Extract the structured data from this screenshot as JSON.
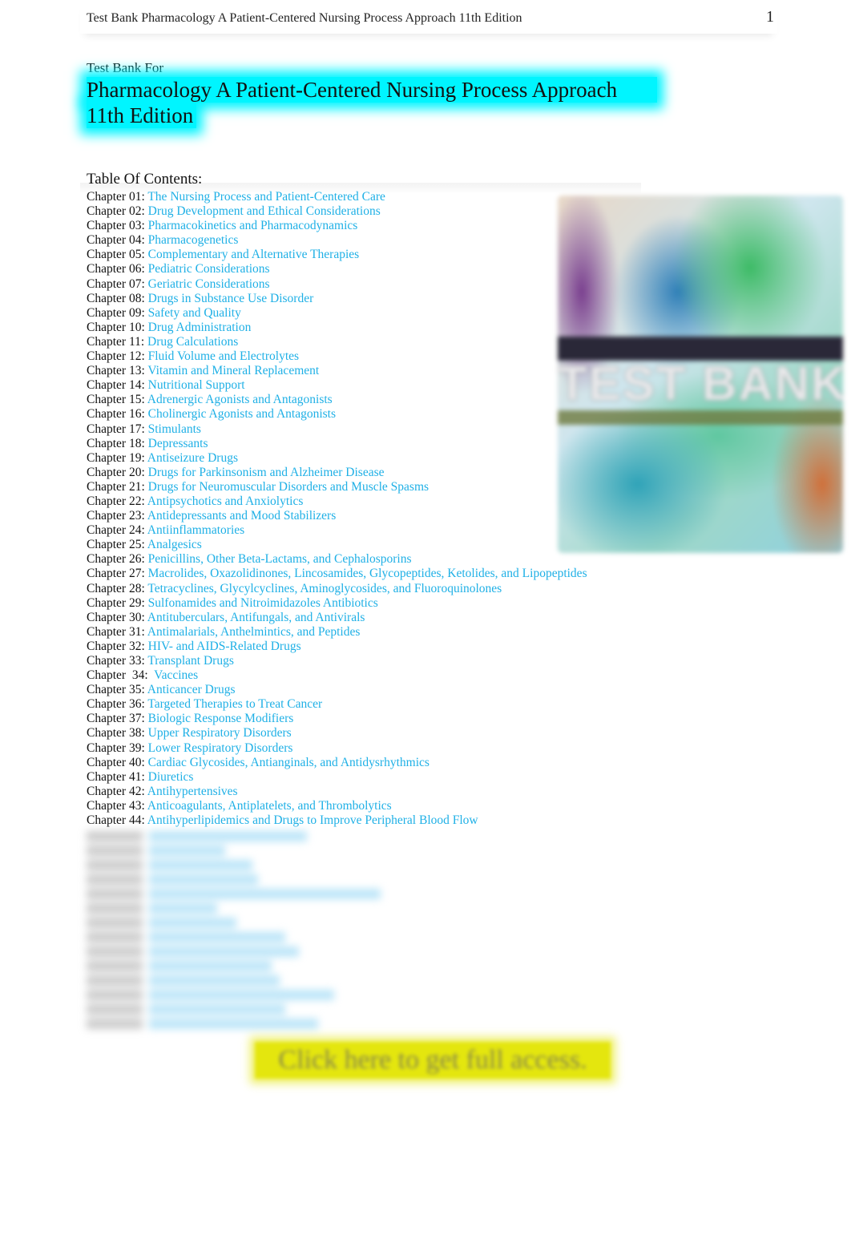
{
  "header": {
    "title": "Test Bank Pharmacology A Patient-Centered Nursing Process Approach 11th Edition",
    "page_number": "1"
  },
  "document": {
    "subtitle": "Test Bank For",
    "title_line1": "Pharmacology A Patient-Centered Nursing Process Approach",
    "title_line2": "11th  Edition",
    "toc_heading": "Table Of Contents:",
    "cover_image": {
      "icon": "book-cover-image",
      "text": "TEST BANK"
    }
  },
  "toc": [
    {
      "label": "Chapter 01: ",
      "title": "The Nursing Process and Patient-Centered Care"
    },
    {
      "label": "Chapter 02: ",
      "title": "Drug Development and Ethical Considerations"
    },
    {
      "label": "Chapter 03: ",
      "title": "Pharmacokinetics and Pharmacodynamics"
    },
    {
      "label": "Chapter 04: ",
      "title": "Pharmacogenetics"
    },
    {
      "label": "Chapter 05: ",
      "title": "Complementary and Alternative Therapies"
    },
    {
      "label": "Chapter 06: ",
      "title": "Pediatric Considerations"
    },
    {
      "label": "Chapter 07: ",
      "title": "Geriatric Considerations"
    },
    {
      "label": "Chapter 08: ",
      "title": "Drugs in Substance Use Disorder"
    },
    {
      "label": "Chapter 09: ",
      "title": "Safety and Quality"
    },
    {
      "label": "Chapter 10: ",
      "title": "Drug Administration"
    },
    {
      "label": "Chapter 11: ",
      "title": "Drug Calculations"
    },
    {
      "label": "Chapter 12: ",
      "title": "Fluid Volume and Electrolytes"
    },
    {
      "label": "Chapter 13: ",
      "title": "Vitamin and Mineral Replacement"
    },
    {
      "label": "Chapter 14: ",
      "title": "Nutritional Support"
    },
    {
      "label": "Chapter 15: ",
      "title": "Adrenergic Agonists and Antagonists"
    },
    {
      "label": "Chapter 16: ",
      "title": "Cholinergic Agonists and Antagonists"
    },
    {
      "label": "Chapter 17: ",
      "title": "Stimulants"
    },
    {
      "label": "Chapter 18: ",
      "title": "Depressants"
    },
    {
      "label": "Chapter 19: ",
      "title": "Antiseizure Drugs"
    },
    {
      "label": "Chapter 20: ",
      "title": "Drugs for Parkinsonism and Alzheimer Disease"
    },
    {
      "label": "Chapter 21: ",
      "title": "Drugs for Neuromuscular Disorders and Muscle Spasms"
    },
    {
      "label": "Chapter 22: ",
      "title": "Antipsychotics and Anxiolytics"
    },
    {
      "label": "Chapter 23: ",
      "title": "Antidepressants and Mood Stabilizers"
    },
    {
      "label": "Chapter 24: ",
      "title": "Antiinflammatories"
    },
    {
      "label": "Chapter 25: ",
      "title": "Analgesics"
    },
    {
      "label": "Chapter 26: ",
      "title": "Penicillins, Other Beta-Lactams, and Cephalosporins"
    },
    {
      "label": "Chapter 27: ",
      "title": "Macrolides, Oxazolidinones, Lincosamides, Glycopeptides, Ketolides, and Lipopeptides"
    },
    {
      "label": "Chapter 28: ",
      "title": "Tetracyclines, Glycylcyclines, Aminoglycosides, and Fluoroquinolones"
    },
    {
      "label": "Chapter 29: ",
      "title": "Sulfonamides and Nitroimidazoles Antibiotics"
    },
    {
      "label": "Chapter 30: ",
      "title": "Antituberculars, Antifungals, and Antivirals"
    },
    {
      "label": "Chapter 31: ",
      "title": "Antimalarials, Anthelmintics, and Peptides"
    },
    {
      "label": "Chapter 32: ",
      "title": "HIV- and AIDS-Related Drugs"
    },
    {
      "label": "Chapter 33: ",
      "title": "Transplant Drugs"
    },
    {
      "label": "Chapter  34:  ",
      "title": "Vaccines"
    },
    {
      "label": "Chapter 35: ",
      "title": "Anticancer Drugs"
    },
    {
      "label": "Chapter 36: ",
      "title": "Targeted Therapies to Treat Cancer"
    },
    {
      "label": "Chapter 37: ",
      "title": "Biologic Response Modifiers"
    },
    {
      "label": "Chapter 38: ",
      "title": "Upper Respiratory Disorders"
    },
    {
      "label": "Chapter 39: ",
      "title": "Lower Respiratory Disorders"
    },
    {
      "label": "Chapter 40: ",
      "title": "Cardiac Glycosides, Antianginals, and Antidysrhythmics"
    },
    {
      "label": "Chapter 41: ",
      "title": "Diuretics"
    },
    {
      "label": "Chapter 42: ",
      "title": "Antihypertensives"
    },
    {
      "label": "Chapter 43: ",
      "title": "Anticoagulants, Antiplatelets, and Thrombolytics"
    },
    {
      "label": "Chapter 44: ",
      "title": "Antihyperlipidemics and Drugs to Improve Peripheral Blood Flow"
    }
  ],
  "blurred_rows": [
    0.58,
    0.28,
    0.38,
    0.4,
    0.85,
    0.25,
    0.32,
    0.5,
    0.55,
    0.45,
    0.48,
    0.68,
    0.5,
    0.62
  ],
  "cta": {
    "label": "Click here to get full access."
  },
  "colors": {
    "link": "#1fb0e6",
    "title_highlight": "#00f5ff",
    "cta_highlight": "#e4e60e"
  }
}
